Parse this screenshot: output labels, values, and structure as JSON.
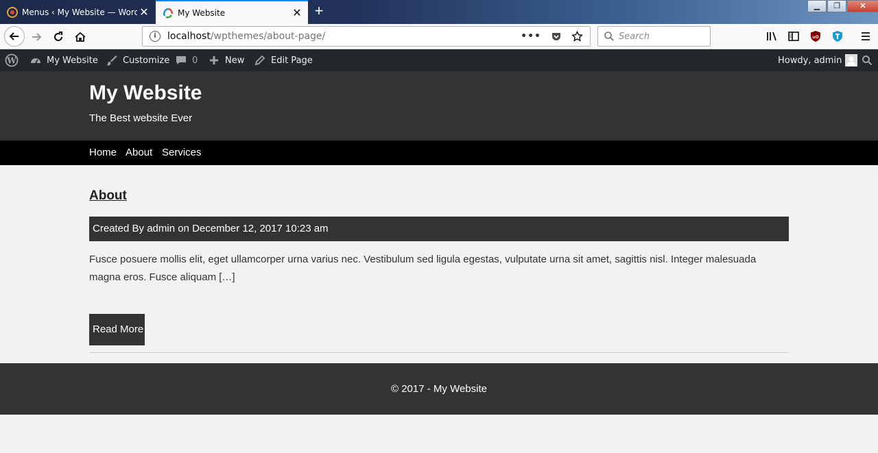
{
  "browser": {
    "tabs": [
      {
        "title": "Menus ‹ My Website — WordPress",
        "active": false
      },
      {
        "title": "My Website",
        "active": true
      }
    ],
    "url": {
      "host": "localhost",
      "path": "/wpthemes/about-page/"
    },
    "search_placeholder": "Search",
    "icons": {
      "back": "back-arrow-icon",
      "forward": "forward-arrow-icon",
      "reload": "reload-icon",
      "home": "home-icon",
      "more": "ellipsis-icon",
      "pocket": "pocket-icon",
      "bookmark": "star-icon",
      "library": "library-icon",
      "sidebar": "sidebar-icon",
      "ublock": "ublock-icon",
      "shield": "shield-icon",
      "menu": "hamburger-icon"
    },
    "accent": "#0a84ff"
  },
  "adminbar": {
    "site_name": "My Website",
    "customize": "Customize",
    "comments_count": "0",
    "new": "New",
    "edit_page": "Edit Page",
    "howdy": "Howdy, admin",
    "bg": "#23282d"
  },
  "site": {
    "title": "My Website",
    "description": "The Best website Ever",
    "nav": [
      "Home",
      "About",
      "Services"
    ]
  },
  "post": {
    "title": "About",
    "meta": "Created By admin on December 12, 2017 10:23 am",
    "excerpt": "Fusce posuere mollis elit, eget ullamcorper urna varius nec. Vestibulum sed ligula egestas, vulputate urna sit amet, sagittis nisl. Integer malesuada magna eros. Fusce aliquam […]",
    "read_more": "Read More"
  },
  "footer": {
    "text": "© 2017 - My Website"
  }
}
